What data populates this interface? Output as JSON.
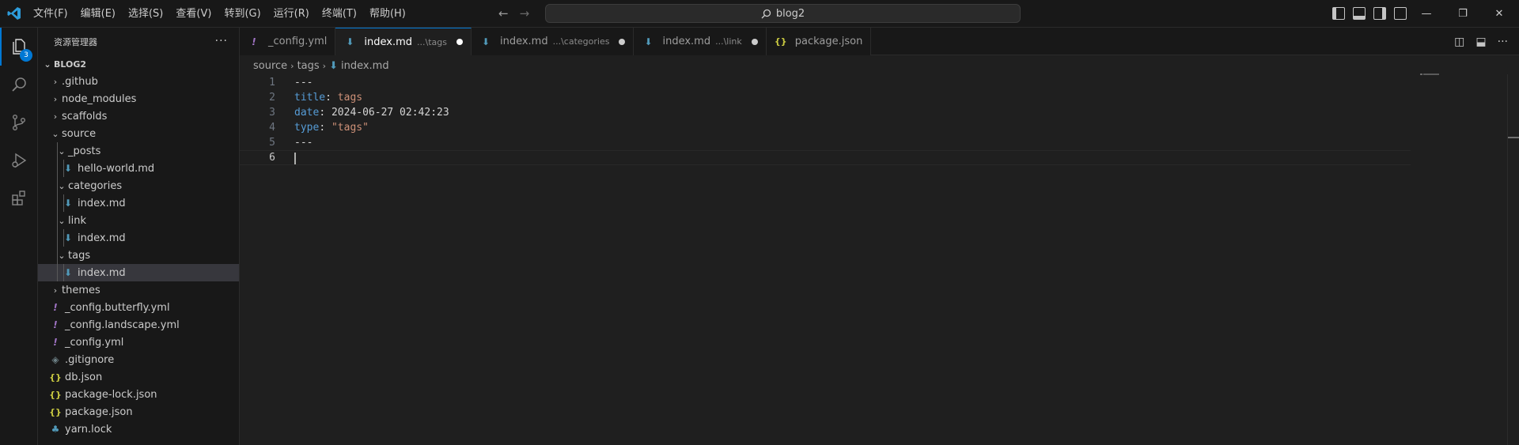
{
  "menu": [
    "文件(F)",
    "编辑(E)",
    "选择(S)",
    "查看(V)",
    "转到(G)",
    "运行(R)",
    "终端(T)",
    "帮助(H)"
  ],
  "command_center": {
    "text": "blog2",
    "icon": "search-icon"
  },
  "window_controls": [
    "—",
    "❐",
    "✕"
  ],
  "activity": {
    "explorer_badge": "3"
  },
  "sidebar": {
    "title": "资源管理器",
    "more": "···",
    "section": "BLOG2",
    "tree": [
      {
        "label": ".github",
        "depth": 0,
        "chevron": "›",
        "icon": ""
      },
      {
        "label": "node_modules",
        "depth": 0,
        "chevron": "›",
        "icon": ""
      },
      {
        "label": "scaffolds",
        "depth": 0,
        "chevron": "›",
        "icon": ""
      },
      {
        "label": "source",
        "depth": 0,
        "chevron": "⌄",
        "icon": ""
      },
      {
        "label": "_posts",
        "depth": 1,
        "chevron": "⌄",
        "icon": ""
      },
      {
        "label": "hello-world.md",
        "depth": 2,
        "chevron": "",
        "icon": "md"
      },
      {
        "label": "categories",
        "depth": 1,
        "chevron": "⌄",
        "icon": ""
      },
      {
        "label": "index.md",
        "depth": 2,
        "chevron": "",
        "icon": "md"
      },
      {
        "label": "link",
        "depth": 1,
        "chevron": "⌄",
        "icon": ""
      },
      {
        "label": "index.md",
        "depth": 2,
        "chevron": "",
        "icon": "md"
      },
      {
        "label": "tags",
        "depth": 1,
        "chevron": "⌄",
        "icon": ""
      },
      {
        "label": "index.md",
        "depth": 2,
        "chevron": "",
        "icon": "md",
        "selected": true
      },
      {
        "label": "themes",
        "depth": 0,
        "chevron": "›",
        "icon": ""
      },
      {
        "label": "_config.butterfly.yml",
        "depth": 0,
        "chevron": "",
        "icon": "yml"
      },
      {
        "label": "_config.landscape.yml",
        "depth": 0,
        "chevron": "",
        "icon": "yml"
      },
      {
        "label": "_config.yml",
        "depth": 0,
        "chevron": "",
        "icon": "yml"
      },
      {
        "label": ".gitignore",
        "depth": 0,
        "chevron": "",
        "icon": "git"
      },
      {
        "label": "db.json",
        "depth": 0,
        "chevron": "",
        "icon": "json"
      },
      {
        "label": "package-lock.json",
        "depth": 0,
        "chevron": "",
        "icon": "json"
      },
      {
        "label": "package.json",
        "depth": 0,
        "chevron": "",
        "icon": "json"
      },
      {
        "label": "yarn.lock",
        "depth": 0,
        "chevron": "",
        "icon": "yarn"
      }
    ]
  },
  "tabs": [
    {
      "label": "_config.yml",
      "desc": "",
      "icon": "yml",
      "active": false,
      "dirty": false
    },
    {
      "label": "index.md",
      "desc": "...\\tags",
      "icon": "md",
      "active": true,
      "dirty": true
    },
    {
      "label": "index.md",
      "desc": "...\\categories",
      "icon": "md",
      "active": false,
      "dirty": true
    },
    {
      "label": "index.md",
      "desc": "...\\link",
      "icon": "md",
      "active": false,
      "dirty": true
    },
    {
      "label": "package.json",
      "desc": "",
      "icon": "json",
      "active": false,
      "dirty": false
    }
  ],
  "breadcrumb": [
    "source",
    "tags",
    "index.md"
  ],
  "editor": {
    "lines": [
      {
        "n": "1",
        "parts": [
          [
            "d",
            "---"
          ]
        ]
      },
      {
        "n": "2",
        "parts": [
          [
            "k",
            "title"
          ],
          [
            "d",
            ": "
          ],
          [
            "v",
            "tags"
          ]
        ]
      },
      {
        "n": "3",
        "parts": [
          [
            "k",
            "date"
          ],
          [
            "d",
            ": 2024-06-27 02:42:23"
          ]
        ]
      },
      {
        "n": "4",
        "parts": [
          [
            "k",
            "type"
          ],
          [
            "d",
            ": "
          ],
          [
            "v",
            "\"tags\""
          ]
        ]
      },
      {
        "n": "5",
        "parts": [
          [
            "d",
            "---"
          ]
        ]
      },
      {
        "n": "6",
        "parts": []
      }
    ],
    "current_line": 6
  },
  "icon_glyphs": {
    "md": "⬇",
    "yml": "!",
    "json": "{}",
    "git": "◈",
    "yarn": "♣"
  }
}
